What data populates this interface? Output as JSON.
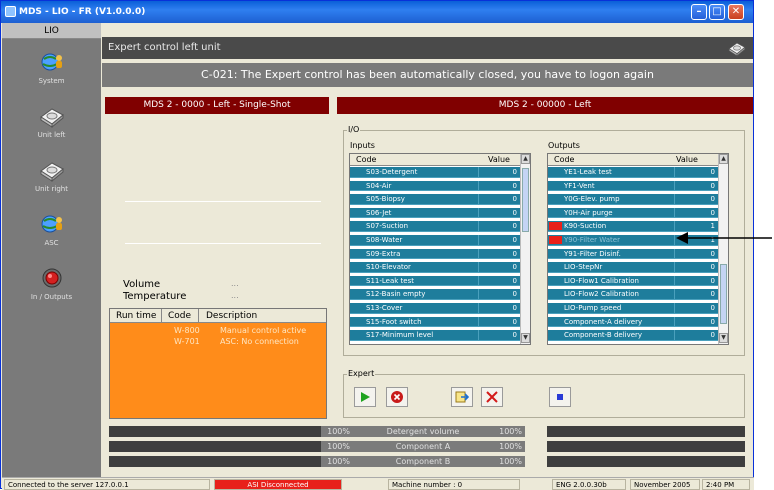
{
  "window": {
    "title": "MDS - LIO - FR  (V1.0.0.0)",
    "buttons": {
      "minimize": "–",
      "maximize": "□",
      "close": "✕"
    }
  },
  "nav": {
    "header": "LIO",
    "items": [
      {
        "label": "System",
        "icon": "globe-user-icon"
      },
      {
        "label": "Unit left",
        "icon": "disc-drive-icon"
      },
      {
        "label": "Unit right",
        "icon": "disc-drive-icon"
      },
      {
        "label": "ASC",
        "icon": "globe-user-icon"
      },
      {
        "label": "In / Outputs",
        "icon": "red-sensor-icon"
      }
    ]
  },
  "header": {
    "title": "Expert control left unit",
    "icon": "disc-drive-icon"
  },
  "message": "C-021: The Expert control has been automatically closed, you have to logon again",
  "left_panel": {
    "title": "MDS 2 - 0000 - Left - Single-Shot",
    "volume_label": "Volume",
    "volume_value": "...",
    "temperature_label": "Temperature",
    "temperature_value": "...",
    "alarm_columns": [
      "Run time",
      "Code",
      "Description"
    ],
    "alarms": [
      {
        "code": "W-800",
        "description": "Manual control active"
      },
      {
        "code": "W-701",
        "description": "ASC: No connection"
      }
    ]
  },
  "right_panel": {
    "title": "MDS 2 - 00000 - Left",
    "io_label": "I/O",
    "inputs_label": "Inputs",
    "outputs_label": "Outputs",
    "columns": {
      "code": "Code",
      "value": "Value"
    },
    "inputs": [
      {
        "code": "S03-Detergent",
        "value": "0"
      },
      {
        "code": "S04-Air",
        "value": "0"
      },
      {
        "code": "S05-Biopsy",
        "value": "0"
      },
      {
        "code": "S06-Jet",
        "value": "0"
      },
      {
        "code": "S07-Suction",
        "value": "0"
      },
      {
        "code": "S08-Water",
        "value": "0"
      },
      {
        "code": "S09-Extra",
        "value": "0"
      },
      {
        "code": "S10-Elevator",
        "value": "0"
      },
      {
        "code": "S11-Leak test",
        "value": "0"
      },
      {
        "code": "S12-Basin empty",
        "value": "0"
      },
      {
        "code": "S13-Cover",
        "value": "0"
      },
      {
        "code": "S15-Foot switch",
        "value": "0"
      },
      {
        "code": "S17-Minimum level",
        "value": "0"
      }
    ],
    "outputs": [
      {
        "code": "YE1-Leak test",
        "value": "0",
        "active": false
      },
      {
        "code": "YF1-Vent",
        "value": "0",
        "active": false
      },
      {
        "code": "Y0G-Elev. pump",
        "value": "0",
        "active": false
      },
      {
        "code": "Y0H-Air purge",
        "value": "0",
        "active": false
      },
      {
        "code": "K90-Suction",
        "value": "1",
        "active": true
      },
      {
        "code": "Y90-Filter Water",
        "value": "1",
        "active": true
      },
      {
        "code": "Y91-Filter Disinf.",
        "value": "0",
        "active": false
      },
      {
        "code": "LIO-StepNr",
        "value": "0",
        "active": false
      },
      {
        "code": "LIO-Flow1 Calibration",
        "value": "0",
        "active": false
      },
      {
        "code": "LIO-Flow2 Calibration",
        "value": "0",
        "active": false
      },
      {
        "code": "LIO-Pump speed",
        "value": "0",
        "active": false
      },
      {
        "code": "Component-A delivery",
        "value": "0",
        "active": false
      },
      {
        "code": "Component-B delivery",
        "value": "0",
        "active": false
      }
    ],
    "expert_label": "Expert"
  },
  "progress": [
    {
      "pct1": "100%",
      "label": "Detergent volume",
      "pct2": "100%"
    },
    {
      "pct1": "100%",
      "label": "Component A",
      "pct2": "100%"
    },
    {
      "pct1": "100%",
      "label": "Component B",
      "pct2": "100%"
    }
  ],
  "status": {
    "connection": "Connected to the server 127.0.0.1",
    "asi": "ASI Disconnected",
    "machine": "Machine number : 0",
    "version": "ENG 2.0.0.30b",
    "date": "November 2005",
    "time": "2:40 PM"
  },
  "colors": {
    "title_bar": "#1d5fd1",
    "panel_header": "#800000",
    "io_row": "#1e7d9c",
    "active_indicator": "#e8201a",
    "alarm_background": "#ff8c1a",
    "asi_status": "#e8201a"
  }
}
